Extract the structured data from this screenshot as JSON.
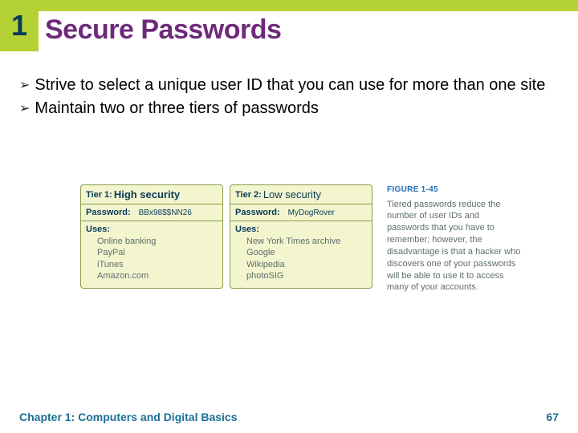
{
  "chapterNumber": "1",
  "title": "Secure Passwords",
  "bullets": [
    "Strive to select a unique user ID that you can use for more than one site",
    "Maintain two or three tiers of passwords"
  ],
  "tiers": [
    {
      "tierLabel": "Tier 1:",
      "securityLabel": "High security",
      "passwordLabel": "Password:",
      "passwordValue": "BBx98$$NN26",
      "usesLabel": "Uses:",
      "uses": [
        "Online banking",
        "PayPal",
        "iTunes",
        "Amazon.com"
      ]
    },
    {
      "tierLabel": "Tier 2:",
      "securityLabel": "Low security",
      "passwordLabel": "Password:",
      "passwordValue": "MyDogRover",
      "usesLabel": "Uses:",
      "uses": [
        "New York Times archive",
        "Google",
        "Wikipedia",
        "photoSIG"
      ]
    }
  ],
  "caption": {
    "label": "FIGURE 1-45",
    "text": "Tiered passwords reduce the number of user IDs and passwords that you have to remember; however, the disadvantage is that a hacker who discovers one of your passwords will be able to use it to access many of your accounts."
  },
  "footer": {
    "chapter": "Chapter 1: Computers and Digital Basics",
    "page": "67"
  }
}
